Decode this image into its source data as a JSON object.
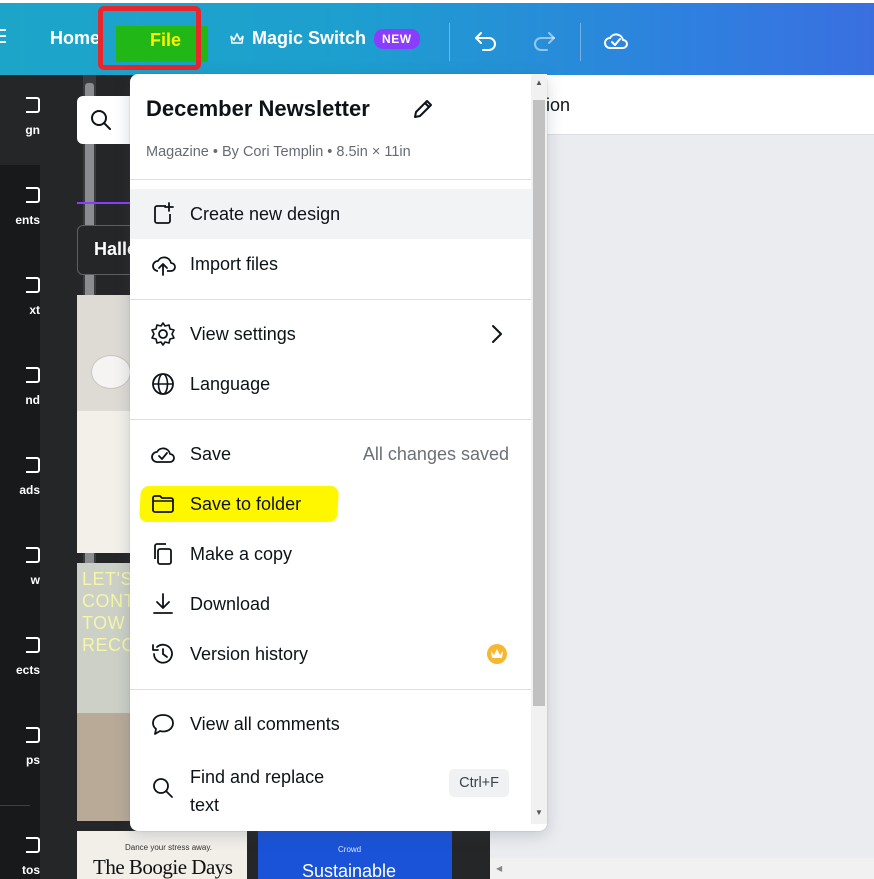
{
  "topbar": {
    "home_label": "Home",
    "file_label": "File",
    "magic_switch_label": "Magic Switch",
    "new_badge": "NEW"
  },
  "side_rail": {
    "items": [
      "gn",
      "ents",
      "xt",
      "nd",
      "ads",
      "w",
      "ects",
      "ps",
      "tos"
    ]
  },
  "side_panel": {
    "chip_label": "Hallo",
    "thumb2_text": "LET'S CONT TOW RECO",
    "thumb3_small": "Dance your stress away.",
    "thumb3_big": "The Boogie Days",
    "thumb4_small": "Crowd",
    "thumb4_big": "Sustainable"
  },
  "canvas": {
    "toolbar_fragment": "tion"
  },
  "file_menu": {
    "title": "December Newsletter",
    "meta": "Magazine • By Cori Templin • 8.5in × 11in",
    "items": {
      "create": "Create new design",
      "import": "Import files",
      "view_settings": "View settings",
      "language": "Language",
      "save": "Save",
      "save_status": "All changes saved",
      "save_folder": "Save to folder",
      "copy": "Make a copy",
      "download": "Download",
      "version_history": "Version history",
      "comments": "View all comments",
      "find_replace_1": "Find and replace",
      "find_replace_2": "text",
      "find_shortcut": "Ctrl+F"
    }
  },
  "colors": {
    "topbar_start": "#1da5c9",
    "topbar_end": "#3a6fe0",
    "file_highlight": "#21b716",
    "file_text": "#fff200",
    "annotation_red": "#e8262b",
    "annotation_yellow": "#fff700",
    "badge_purple": "#8b3dff",
    "crown_gold": "#f5b82e"
  }
}
